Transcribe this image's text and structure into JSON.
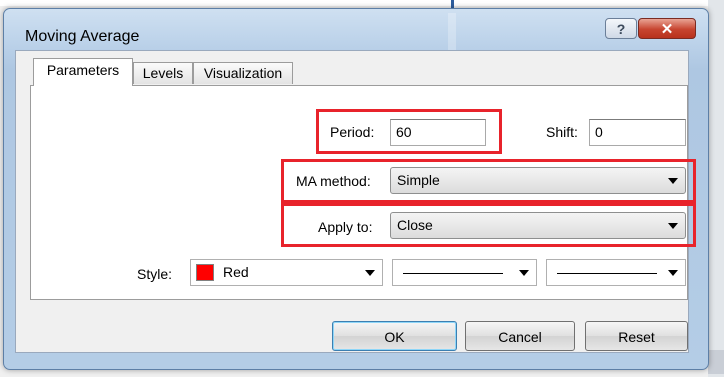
{
  "window": {
    "title": "Moving Average"
  },
  "titlebar_buttons": {
    "help_icon": "?",
    "close_icon": "✕"
  },
  "tabs": [
    {
      "label": "Parameters",
      "active": true
    },
    {
      "label": "Levels",
      "active": false
    },
    {
      "label": "Visualization",
      "active": false
    }
  ],
  "params": {
    "period_label": "Period:",
    "period_value": "60",
    "shift_label": "Shift:",
    "shift_value": "0",
    "ma_method_label": "MA method:",
    "ma_method_value": "Simple",
    "apply_to_label": "Apply to:",
    "apply_to_value": "Close",
    "style_label": "Style:",
    "style_color_name": "Red",
    "style_color_hex": "#ff0000"
  },
  "buttons": {
    "ok": "OK",
    "cancel": "Cancel",
    "reset": "Reset"
  },
  "colors": {
    "highlight": "#e8232b",
    "title_gradient_top": "#cfe0f1"
  }
}
